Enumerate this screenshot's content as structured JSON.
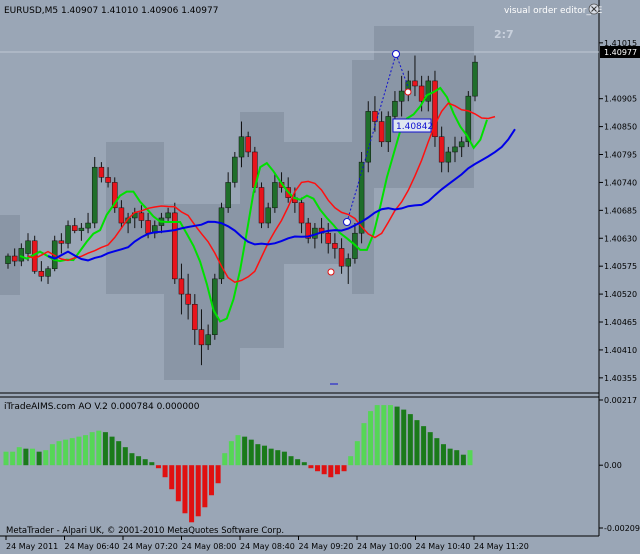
{
  "header": {
    "symbol_info": "EURUSD,M5  1.40907 1.41010 1.40906 1.40977",
    "tool_label": "visual order editor_EE",
    "timer_label": "2:7",
    "close-icon": "close-icon"
  },
  "order_line_label": "1.40842",
  "indicator": {
    "label": "iTradeAIMS.com AO V.2 0.000784 0.000000",
    "copyright": "MetaTrader - Alpari UK, © 2001-2010 MetaQuotes Software Corp.",
    "y_ticks": [
      "0.00217",
      "0.00",
      "-0.00209"
    ]
  },
  "colors": {
    "background": "#9aa6b6",
    "bull_candle": "#1f6e2a",
    "bear_candle": "#e8141c",
    "green_ma": "#00e000",
    "red_ma": "#ff1010",
    "blue_ma": "#0000e8",
    "ao_up": "#56d656",
    "ao_up_dark": "#1a7a1a",
    "ao_down": "#e01010"
  },
  "chart_data": {
    "type": "candlestick",
    "y_ticks": [
      "1.41015",
      "1.40977",
      "1.40905",
      "1.40850",
      "1.40795",
      "1.40740",
      "1.40685",
      "1.40630",
      "1.40575",
      "1.40520",
      "1.40465",
      "1.40410",
      "1.40355"
    ],
    "current_price": "1.40977",
    "x_ticks": [
      "24 May 2011",
      "24 May 06:40",
      "24 May 07:20",
      "24 May 08:00",
      "24 May 08:40",
      "24 May 09:20",
      "24 May 10:00",
      "24 May 10:40",
      "24 May 11:20"
    ],
    "ylim": [
      1.40335,
      1.4106
    ],
    "candles": [
      [
        1.4058,
        1.406,
        1.4057,
        1.40595
      ],
      [
        1.40595,
        1.4061,
        1.40575,
        1.40585
      ],
      [
        1.40585,
        1.4062,
        1.40575,
        1.4061
      ],
      [
        1.406,
        1.4064,
        1.40585,
        1.40625
      ],
      [
        1.40625,
        1.40635,
        1.4056,
        1.40565
      ],
      [
        1.40565,
        1.40585,
        1.40545,
        1.40555
      ],
      [
        1.40555,
        1.40575,
        1.4054,
        1.4057
      ],
      [
        1.4057,
        1.40635,
        1.40565,
        1.40625
      ],
      [
        1.40625,
        1.4064,
        1.406,
        1.4062
      ],
      [
        1.4062,
        1.40665,
        1.4061,
        1.40655
      ],
      [
        1.40655,
        1.4067,
        1.4064,
        1.40645
      ],
      [
        1.40645,
        1.4066,
        1.40625,
        1.4065
      ],
      [
        1.4065,
        1.4068,
        1.4064,
        1.4066
      ],
      [
        1.4066,
        1.4079,
        1.4065,
        1.4077
      ],
      [
        1.4077,
        1.4078,
        1.4074,
        1.4075
      ],
      [
        1.4075,
        1.4077,
        1.4073,
        1.4074
      ],
      [
        1.4074,
        1.4075,
        1.4068,
        1.4069
      ],
      [
        1.4069,
        1.40705,
        1.4065,
        1.4066
      ],
      [
        1.4066,
        1.4068,
        1.4064,
        1.4067
      ],
      [
        1.4067,
        1.4069,
        1.4065,
        1.4068
      ],
      [
        1.4068,
        1.40695,
        1.4065,
        1.40665
      ],
      [
        1.40665,
        1.4068,
        1.4063,
        1.4064
      ],
      [
        1.4064,
        1.40665,
        1.4063,
        1.40655
      ],
      [
        1.40655,
        1.4068,
        1.4064,
        1.4067
      ],
      [
        1.4067,
        1.4069,
        1.4066,
        1.4068
      ],
      [
        1.4068,
        1.407,
        1.4054,
        1.4055
      ],
      [
        1.4055,
        1.4058,
        1.4048,
        1.4052
      ],
      [
        1.4052,
        1.4056,
        1.4047,
        1.405
      ],
      [
        1.405,
        1.4052,
        1.4042,
        1.4045
      ],
      [
        1.4045,
        1.4049,
        1.4038,
        1.4042
      ],
      [
        1.4042,
        1.4046,
        1.4041,
        1.4044
      ],
      [
        1.4044,
        1.4056,
        1.4043,
        1.4055
      ],
      [
        1.4055,
        1.407,
        1.4054,
        1.4069
      ],
      [
        1.4069,
        1.4076,
        1.4068,
        1.4074
      ],
      [
        1.4074,
        1.408,
        1.4073,
        1.4079
      ],
      [
        1.4079,
        1.4086,
        1.4077,
        1.4083
      ],
      [
        1.4083,
        1.4084,
        1.4079,
        1.408
      ],
      [
        1.408,
        1.4081,
        1.4072,
        1.4073
      ],
      [
        1.4073,
        1.4074,
        1.4065,
        1.4066
      ],
      [
        1.4066,
        1.407,
        1.4065,
        1.4069
      ],
      [
        1.4069,
        1.4076,
        1.4068,
        1.4074
      ],
      [
        1.4074,
        1.4076,
        1.4072,
        1.4073
      ],
      [
        1.4073,
        1.4075,
        1.407,
        1.4071
      ],
      [
        1.4071,
        1.4073,
        1.4068,
        1.407
      ],
      [
        1.407,
        1.4071,
        1.4064,
        1.4066
      ],
      [
        1.4066,
        1.4067,
        1.4062,
        1.4063
      ],
      [
        1.4063,
        1.4066,
        1.4061,
        1.4065
      ],
      [
        1.4065,
        1.4067,
        1.4062,
        1.4064
      ],
      [
        1.4064,
        1.4066,
        1.406,
        1.4062
      ],
      [
        1.4062,
        1.4064,
        1.4059,
        1.4061
      ],
      [
        1.4061,
        1.4063,
        1.4056,
        1.40575
      ],
      [
        1.40575,
        1.406,
        1.4054,
        1.4059
      ],
      [
        1.4059,
        1.4066,
        1.4058,
        1.4064
      ],
      [
        1.4064,
        1.408,
        1.4062,
        1.4078
      ],
      [
        1.4078,
        1.409,
        1.4076,
        1.4088
      ],
      [
        1.4088,
        1.4091,
        1.4084,
        1.4086
      ],
      [
        1.4086,
        1.4088,
        1.4081,
        1.4082
      ],
      [
        1.4082,
        1.4088,
        1.408,
        1.4087
      ],
      [
        1.4087,
        1.4092,
        1.4085,
        1.409
      ],
      [
        1.409,
        1.4095,
        1.4087,
        1.4092
      ],
      [
        1.4092,
        1.4096,
        1.409,
        1.4094
      ],
      [
        1.4094,
        1.4099,
        1.4091,
        1.4093
      ],
      [
        1.4093,
        1.4095,
        1.4088,
        1.409
      ],
      [
        1.409,
        1.4095,
        1.4088,
        1.4094
      ],
      [
        1.4094,
        1.4096,
        1.4081,
        1.4083
      ],
      [
        1.4083,
        1.4085,
        1.4076,
        1.4078
      ],
      [
        1.4078,
        1.4081,
        1.4076,
        1.408
      ],
      [
        1.408,
        1.4083,
        1.4078,
        1.4081
      ],
      [
        1.4081,
        1.4083,
        1.4079,
        1.4082
      ],
      [
        1.4082,
        1.4092,
        1.4081,
        1.4091
      ],
      [
        1.4091,
        1.4099,
        1.409,
        1.40977
      ]
    ],
    "ao": [
      0.00045,
      0.00045,
      0.0006,
      0.00055,
      0.00055,
      0.00045,
      0.0005,
      0.0007,
      0.0008,
      0.00085,
      0.0009,
      0.00095,
      0.001,
      0.0011,
      0.00115,
      0.0011,
      0.00095,
      0.0008,
      0.0006,
      0.0004,
      0.0003,
      0.0002,
      0.0001,
      -0.0001,
      -0.0004,
      -0.0008,
      -0.0012,
      -0.0016,
      -0.0019,
      -0.0017,
      -0.0014,
      -0.001,
      -0.0006,
      0.0004,
      0.0008,
      0.001,
      0.00095,
      0.00085,
      0.0007,
      0.00065,
      0.00055,
      0.0005,
      0.00045,
      0.0003,
      0.0002,
      0.0001,
      -0.0001,
      -0.0002,
      -0.0003,
      -0.0004,
      -0.0003,
      -0.0002,
      0.0003,
      0.0008,
      0.0014,
      0.0018,
      0.002,
      0.002,
      0.002,
      0.00195,
      0.00185,
      0.0017,
      0.0015,
      0.0013,
      0.0011,
      0.0009,
      0.0007,
      0.00055,
      0.0005,
      0.00035,
      0.0005
    ]
  }
}
